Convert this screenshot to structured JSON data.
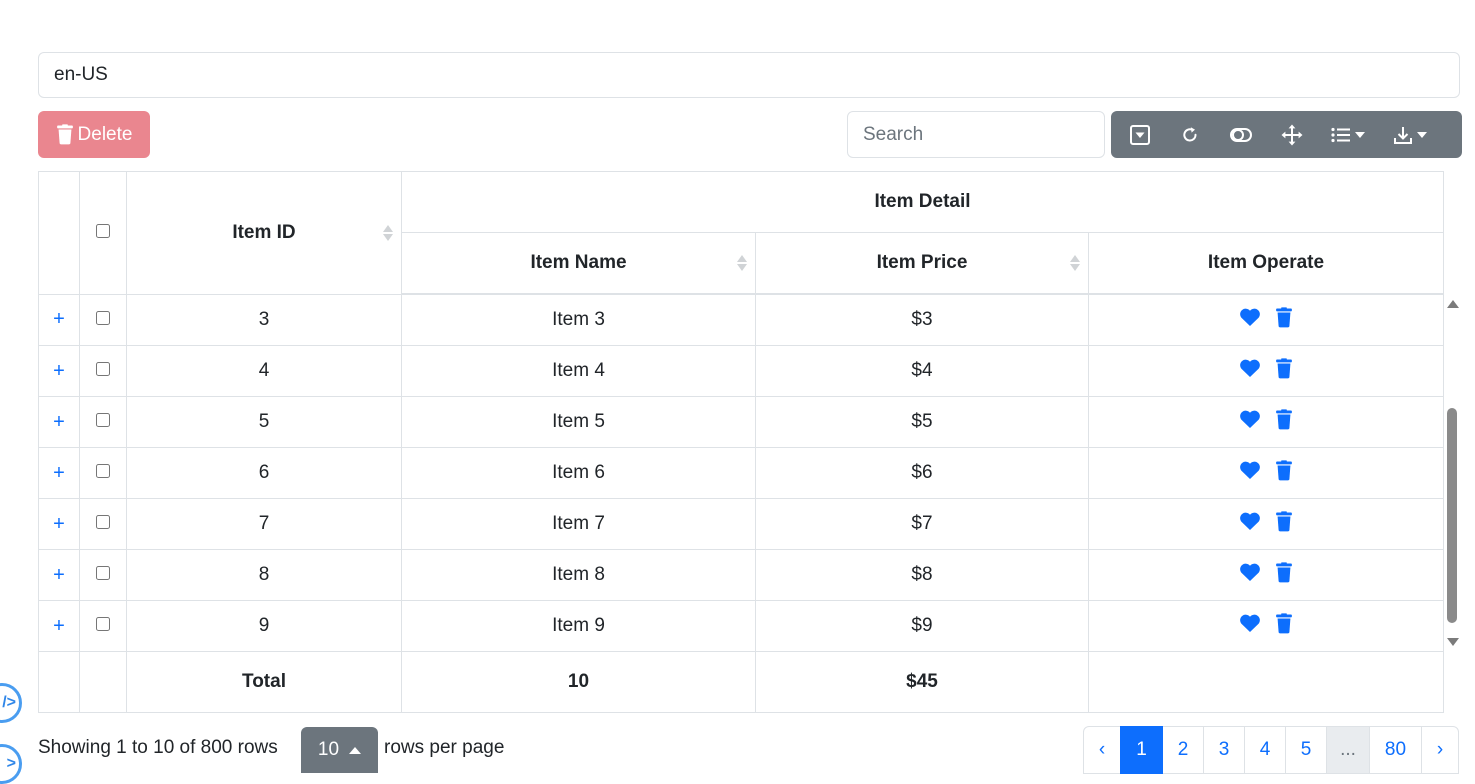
{
  "locale": "en-US",
  "toolbar": {
    "delete_label": "Delete",
    "search_placeholder": "Search"
  },
  "table": {
    "group_header": "Item Detail",
    "columns": {
      "id": "Item ID",
      "name": "Item Name",
      "price": "Item Price",
      "operate": "Item Operate"
    },
    "rows": [
      {
        "expand": "+",
        "id": "3",
        "name": "Item 3",
        "price": "$3"
      },
      {
        "expand": "+",
        "id": "4",
        "name": "Item 4",
        "price": "$4"
      },
      {
        "expand": "+",
        "id": "5",
        "name": "Item 5",
        "price": "$5"
      },
      {
        "expand": "+",
        "id": "6",
        "name": "Item 6",
        "price": "$6"
      },
      {
        "expand": "+",
        "id": "7",
        "name": "Item 7",
        "price": "$7"
      },
      {
        "expand": "+",
        "id": "8",
        "name": "Item 8",
        "price": "$8"
      },
      {
        "expand": "+",
        "id": "9",
        "name": "Item 9",
        "price": "$9"
      }
    ],
    "footer": {
      "label": "Total",
      "name_total": "10",
      "price_total": "$45"
    }
  },
  "pagination": {
    "summary": "Showing 1 to 10 of 800 rows",
    "page_size": "10",
    "page_size_suffix": "rows per page",
    "prev": "‹",
    "pages": [
      "1",
      "2",
      "3",
      "4",
      "5"
    ],
    "ellipsis": "...",
    "last_page": "80",
    "next": "›",
    "active_page": "1"
  },
  "colors": {
    "primary": "#0d6efd",
    "danger_disabled": "#ea868f",
    "secondary": "#6c757d"
  }
}
